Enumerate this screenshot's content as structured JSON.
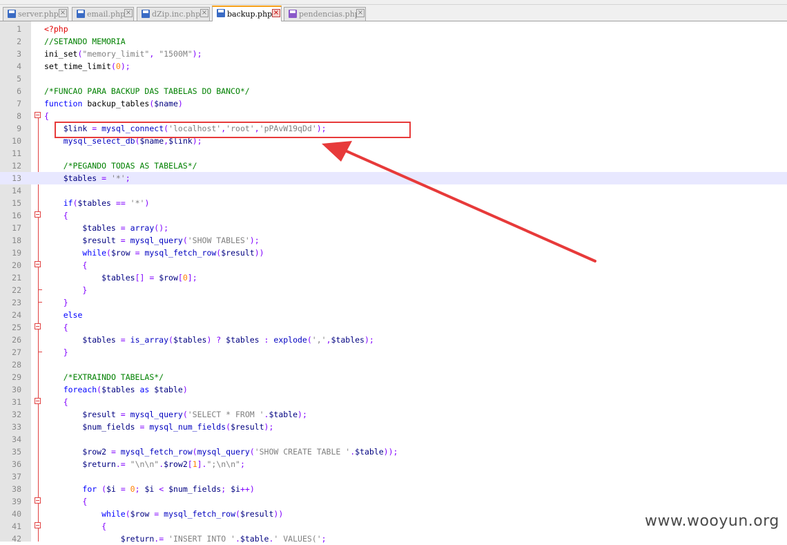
{
  "tabs": [
    {
      "label": "server.php",
      "active": false,
      "modified": false
    },
    {
      "label": "email.php",
      "active": false,
      "modified": false
    },
    {
      "label": "dZip.inc.php",
      "active": false,
      "modified": false
    },
    {
      "label": "backup.php",
      "active": true,
      "modified": false
    },
    {
      "label": "pendencias.php",
      "active": false,
      "modified": true
    }
  ],
  "watermark": "www.wooyun.org",
  "lines": [
    {
      "n": "1",
      "fold": "none",
      "tokens": [
        [
          "t-tag",
          "<?php"
        ]
      ]
    },
    {
      "n": "2",
      "fold": "none",
      "tokens": [
        [
          "t-cmt",
          "//SETANDO MEMORIA"
        ]
      ]
    },
    {
      "n": "3",
      "fold": "none",
      "tokens": [
        [
          "t-def",
          "ini_set"
        ],
        [
          "t-op",
          "("
        ],
        [
          "t-str",
          "\"memory_limit\""
        ],
        [
          "t-op",
          ", "
        ],
        [
          "t-str",
          "\"1500M\""
        ],
        [
          "t-op",
          ");"
        ]
      ]
    },
    {
      "n": "4",
      "fold": "none",
      "tokens": [
        [
          "t-def",
          "set_time_limit"
        ],
        [
          "t-op",
          "("
        ],
        [
          "t-num",
          "0"
        ],
        [
          "t-op",
          ");"
        ]
      ]
    },
    {
      "n": "5",
      "fold": "none",
      "tokens": []
    },
    {
      "n": "6",
      "fold": "none",
      "tokens": [
        [
          "t-cmt",
          "/*FUNCAO PARA BACKUP DAS TABELAS DO BANCO*/"
        ]
      ]
    },
    {
      "n": "7",
      "fold": "none",
      "tokens": [
        [
          "t-kw",
          "function"
        ],
        [
          "t-def",
          " backup_tables"
        ],
        [
          "t-op",
          "("
        ],
        [
          "t-var",
          "$name"
        ],
        [
          "t-op",
          ")"
        ]
      ]
    },
    {
      "n": "8",
      "fold": "open",
      "tokens": [
        [
          "t-op",
          "{"
        ]
      ]
    },
    {
      "n": "9",
      "fold": "none",
      "tokens": [
        [
          "t-def",
          "    "
        ],
        [
          "t-var",
          "$link"
        ],
        [
          "t-op",
          " = "
        ],
        [
          "t-fn",
          "mysql_connect"
        ],
        [
          "t-op",
          "("
        ],
        [
          "t-str",
          "'localhost'"
        ],
        [
          "t-op",
          ","
        ],
        [
          "t-str",
          "'root'"
        ],
        [
          "t-op",
          ","
        ],
        [
          "t-str",
          "'pPAvW19qDd'"
        ],
        [
          "t-op",
          ");"
        ]
      ]
    },
    {
      "n": "10",
      "fold": "none",
      "tokens": [
        [
          "t-def",
          "    "
        ],
        [
          "t-fn",
          "mysql_select_db"
        ],
        [
          "t-op",
          "("
        ],
        [
          "t-var",
          "$name"
        ],
        [
          "t-op",
          ","
        ],
        [
          "t-var",
          "$link"
        ],
        [
          "t-op",
          ");"
        ]
      ]
    },
    {
      "n": "11",
      "fold": "none",
      "tokens": []
    },
    {
      "n": "12",
      "fold": "none",
      "tokens": [
        [
          "t-def",
          "    "
        ],
        [
          "t-cmt",
          "/*PEGANDO TODAS AS TABELAS*/"
        ]
      ]
    },
    {
      "n": "13",
      "fold": "none",
      "current": true,
      "tokens": [
        [
          "t-def",
          "    "
        ],
        [
          "t-var",
          "$tables"
        ],
        [
          "t-op",
          " = "
        ],
        [
          "t-str",
          "'*'"
        ],
        [
          "t-op",
          ";"
        ]
      ]
    },
    {
      "n": "14",
      "fold": "none",
      "tokens": []
    },
    {
      "n": "15",
      "fold": "none",
      "tokens": [
        [
          "t-def",
          "    "
        ],
        [
          "t-kw",
          "if"
        ],
        [
          "t-op",
          "("
        ],
        [
          "t-var",
          "$tables"
        ],
        [
          "t-op",
          " == "
        ],
        [
          "t-str",
          "'*'"
        ],
        [
          "t-op",
          ")"
        ]
      ]
    },
    {
      "n": "16",
      "fold": "open",
      "tokens": [
        [
          "t-def",
          "    "
        ],
        [
          "t-op",
          "{"
        ]
      ]
    },
    {
      "n": "17",
      "fold": "none",
      "tokens": [
        [
          "t-def",
          "        "
        ],
        [
          "t-var",
          "$tables"
        ],
        [
          "t-op",
          " = "
        ],
        [
          "t-fn",
          "array"
        ],
        [
          "t-op",
          "();"
        ]
      ]
    },
    {
      "n": "18",
      "fold": "none",
      "tokens": [
        [
          "t-def",
          "        "
        ],
        [
          "t-var",
          "$result"
        ],
        [
          "t-op",
          " = "
        ],
        [
          "t-fn",
          "mysql_query"
        ],
        [
          "t-op",
          "("
        ],
        [
          "t-str",
          "'SHOW TABLES'"
        ],
        [
          "t-op",
          ");"
        ]
      ]
    },
    {
      "n": "19",
      "fold": "none",
      "tokens": [
        [
          "t-def",
          "        "
        ],
        [
          "t-kw",
          "while"
        ],
        [
          "t-op",
          "("
        ],
        [
          "t-var",
          "$row"
        ],
        [
          "t-op",
          " = "
        ],
        [
          "t-fn",
          "mysql_fetch_row"
        ],
        [
          "t-op",
          "("
        ],
        [
          "t-var",
          "$result"
        ],
        [
          "t-op",
          "))"
        ]
      ]
    },
    {
      "n": "20",
      "fold": "open",
      "tokens": [
        [
          "t-def",
          "        "
        ],
        [
          "t-op",
          "{"
        ]
      ]
    },
    {
      "n": "21",
      "fold": "none",
      "tokens": [
        [
          "t-def",
          "            "
        ],
        [
          "t-var",
          "$tables"
        ],
        [
          "t-op",
          "[] = "
        ],
        [
          "t-var",
          "$row"
        ],
        [
          "t-op",
          "["
        ],
        [
          "t-num",
          "0"
        ],
        [
          "t-op",
          "];"
        ]
      ]
    },
    {
      "n": "22",
      "fold": "end",
      "tokens": [
        [
          "t-def",
          "        "
        ],
        [
          "t-op",
          "}"
        ]
      ]
    },
    {
      "n": "23",
      "fold": "end",
      "tokens": [
        [
          "t-def",
          "    "
        ],
        [
          "t-op",
          "}"
        ]
      ]
    },
    {
      "n": "24",
      "fold": "none",
      "tokens": [
        [
          "t-def",
          "    "
        ],
        [
          "t-kw",
          "else"
        ]
      ]
    },
    {
      "n": "25",
      "fold": "open",
      "tokens": [
        [
          "t-def",
          "    "
        ],
        [
          "t-op",
          "{"
        ]
      ]
    },
    {
      "n": "26",
      "fold": "none",
      "tokens": [
        [
          "t-def",
          "        "
        ],
        [
          "t-var",
          "$tables"
        ],
        [
          "t-op",
          " = "
        ],
        [
          "t-fn",
          "is_array"
        ],
        [
          "t-op",
          "("
        ],
        [
          "t-var",
          "$tables"
        ],
        [
          "t-op",
          ") ? "
        ],
        [
          "t-var",
          "$tables"
        ],
        [
          "t-op",
          " : "
        ],
        [
          "t-fn",
          "explode"
        ],
        [
          "t-op",
          "("
        ],
        [
          "t-str",
          "','"
        ],
        [
          "t-op",
          ","
        ],
        [
          "t-var",
          "$tables"
        ],
        [
          "t-op",
          ");"
        ]
      ]
    },
    {
      "n": "27",
      "fold": "end",
      "tokens": [
        [
          "t-def",
          "    "
        ],
        [
          "t-op",
          "}"
        ]
      ]
    },
    {
      "n": "28",
      "fold": "none",
      "tokens": []
    },
    {
      "n": "29",
      "fold": "none",
      "tokens": [
        [
          "t-def",
          "    "
        ],
        [
          "t-cmt",
          "/*EXTRAINDO TABELAS*/"
        ]
      ]
    },
    {
      "n": "30",
      "fold": "none",
      "tokens": [
        [
          "t-def",
          "    "
        ],
        [
          "t-kw",
          "foreach"
        ],
        [
          "t-op",
          "("
        ],
        [
          "t-var",
          "$tables"
        ],
        [
          "t-kw",
          " as "
        ],
        [
          "t-var",
          "$table"
        ],
        [
          "t-op",
          ")"
        ]
      ]
    },
    {
      "n": "31",
      "fold": "open",
      "tokens": [
        [
          "t-def",
          "    "
        ],
        [
          "t-op",
          "{"
        ]
      ]
    },
    {
      "n": "32",
      "fold": "none",
      "tokens": [
        [
          "t-def",
          "        "
        ],
        [
          "t-var",
          "$result"
        ],
        [
          "t-op",
          " = "
        ],
        [
          "t-fn",
          "mysql_query"
        ],
        [
          "t-op",
          "("
        ],
        [
          "t-str",
          "'SELECT * FROM '"
        ],
        [
          "t-op",
          "."
        ],
        [
          "t-var",
          "$table"
        ],
        [
          "t-op",
          ");"
        ]
      ]
    },
    {
      "n": "33",
      "fold": "none",
      "tokens": [
        [
          "t-def",
          "        "
        ],
        [
          "t-var",
          "$num_fields"
        ],
        [
          "t-op",
          " = "
        ],
        [
          "t-fn",
          "mysql_num_fields"
        ],
        [
          "t-op",
          "("
        ],
        [
          "t-var",
          "$result"
        ],
        [
          "t-op",
          ");"
        ]
      ]
    },
    {
      "n": "34",
      "fold": "none",
      "tokens": []
    },
    {
      "n": "35",
      "fold": "none",
      "tokens": [
        [
          "t-def",
          "        "
        ],
        [
          "t-var",
          "$row2"
        ],
        [
          "t-op",
          " = "
        ],
        [
          "t-fn",
          "mysql_fetch_row"
        ],
        [
          "t-op",
          "("
        ],
        [
          "t-fn",
          "mysql_query"
        ],
        [
          "t-op",
          "("
        ],
        [
          "t-str",
          "'SHOW CREATE TABLE '"
        ],
        [
          "t-op",
          "."
        ],
        [
          "t-var",
          "$table"
        ],
        [
          "t-op",
          "));"
        ]
      ]
    },
    {
      "n": "36",
      "fold": "none",
      "tokens": [
        [
          "t-def",
          "        "
        ],
        [
          "t-var",
          "$return"
        ],
        [
          "t-op",
          ".= "
        ],
        [
          "t-str",
          "\"\\n\\n\""
        ],
        [
          "t-op",
          "."
        ],
        [
          "t-var",
          "$row2"
        ],
        [
          "t-op",
          "["
        ],
        [
          "t-num",
          "1"
        ],
        [
          "t-op",
          "]."
        ],
        [
          "t-str",
          "\";\\n\\n\""
        ],
        [
          "t-op",
          ";"
        ]
      ]
    },
    {
      "n": "37",
      "fold": "none",
      "tokens": []
    },
    {
      "n": "38",
      "fold": "none",
      "tokens": [
        [
          "t-def",
          "        "
        ],
        [
          "t-kw",
          "for"
        ],
        [
          "t-op",
          " ("
        ],
        [
          "t-var",
          "$i"
        ],
        [
          "t-op",
          " = "
        ],
        [
          "t-num",
          "0"
        ],
        [
          "t-op",
          "; "
        ],
        [
          "t-var",
          "$i"
        ],
        [
          "t-op",
          " < "
        ],
        [
          "t-var",
          "$num_fields"
        ],
        [
          "t-op",
          "; "
        ],
        [
          "t-var",
          "$i"
        ],
        [
          "t-op",
          "++)"
        ]
      ]
    },
    {
      "n": "39",
      "fold": "open",
      "tokens": [
        [
          "t-def",
          "        "
        ],
        [
          "t-op",
          "{"
        ]
      ]
    },
    {
      "n": "40",
      "fold": "none",
      "tokens": [
        [
          "t-def",
          "            "
        ],
        [
          "t-kw",
          "while"
        ],
        [
          "t-op",
          "("
        ],
        [
          "t-var",
          "$row"
        ],
        [
          "t-op",
          " = "
        ],
        [
          "t-fn",
          "mysql_fetch_row"
        ],
        [
          "t-op",
          "("
        ],
        [
          "t-var",
          "$result"
        ],
        [
          "t-op",
          "))"
        ]
      ]
    },
    {
      "n": "41",
      "fold": "open",
      "tokens": [
        [
          "t-def",
          "            "
        ],
        [
          "t-op",
          "{"
        ]
      ]
    },
    {
      "n": "42",
      "fold": "none",
      "tokens": [
        [
          "t-def",
          "                "
        ],
        [
          "t-var",
          "$return"
        ],
        [
          "t-op",
          "."
        ],
        [
          "t-op",
          "= "
        ],
        [
          "t-str",
          "'INSERT INTO '"
        ],
        [
          "t-op",
          "."
        ],
        [
          "t-var",
          "$table"
        ],
        [
          "t-op",
          "."
        ],
        [
          "t-str",
          "' VALUES('"
        ],
        [
          "t-op",
          ";"
        ]
      ]
    }
  ]
}
